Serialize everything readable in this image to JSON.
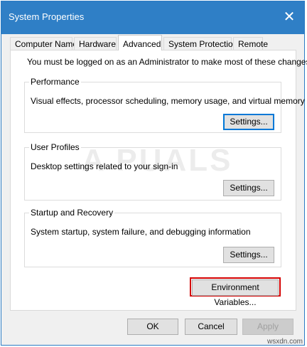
{
  "window": {
    "title": "System Properties",
    "close_glyph": "✕"
  },
  "tabs": [
    {
      "label": "Computer Name"
    },
    {
      "label": "Hardware"
    },
    {
      "label": "Advanced"
    },
    {
      "label": "System Protection"
    },
    {
      "label": "Remote"
    }
  ],
  "active_tab": "Advanced",
  "notice": "You must be logged on as an Administrator to make most of these changes.",
  "groups": {
    "performance": {
      "title": "Performance",
      "description": "Visual effects, processor scheduling, memory usage, and virtual memory",
      "button": "Settings..."
    },
    "user_profiles": {
      "title": "User Profiles",
      "description": "Desktop settings related to your sign-in",
      "button": "Settings..."
    },
    "startup_recovery": {
      "title": "Startup and Recovery",
      "description": "System startup, system failure, and debugging information",
      "button": "Settings..."
    }
  },
  "environment_button": "Environment Variables...",
  "footer": {
    "ok": "OK",
    "cancel": "Cancel",
    "apply": "Apply"
  },
  "watermark": "A  PUALS",
  "site": "wsxdn.com",
  "colors": {
    "titlebar": "#2f7fc6",
    "highlight_box": "#d40000",
    "focus": "#0078d7"
  }
}
